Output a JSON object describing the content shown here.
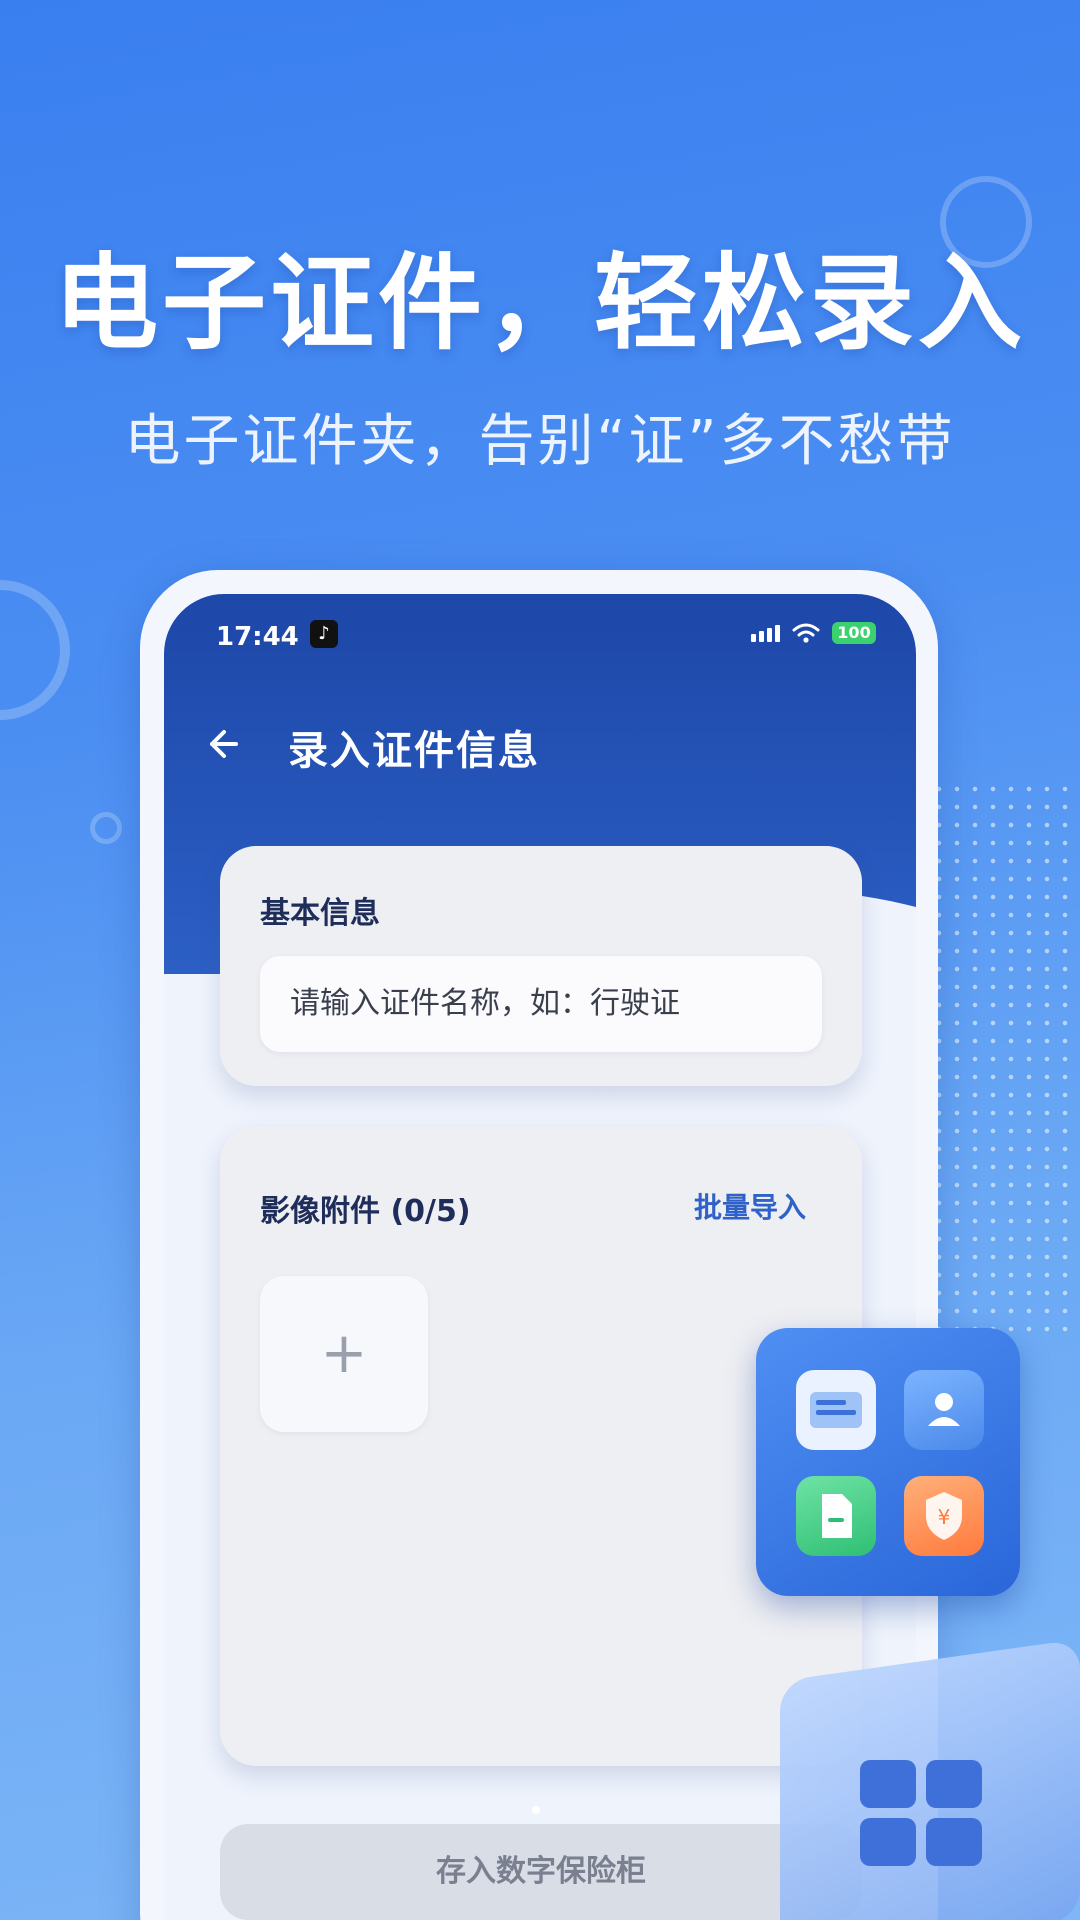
{
  "promo": {
    "headline": "电子证件，轻松录入",
    "subline": "电子证件夹，告别“证”多不愁带"
  },
  "status_bar": {
    "time": "17:44",
    "battery": "100"
  },
  "header": {
    "title": "录入证件信息"
  },
  "basic_info": {
    "title": "基本信息",
    "name_placeholder": "请输入证件名称，如：行驶证"
  },
  "attachments": {
    "title": "影像附件 (0/5)",
    "batch_import_label": "批量导入",
    "add_symbol": "+"
  },
  "actions": {
    "save_label": "存入数字保险柜"
  },
  "floating_icons": [
    "id-card-icon",
    "person-icon",
    "document-icon",
    "yuan-shield-icon"
  ],
  "colors": {
    "header_blue": "#1d47a8",
    "accent_blue": "#2f62c9",
    "disabled_button": "#d9dde6"
  }
}
